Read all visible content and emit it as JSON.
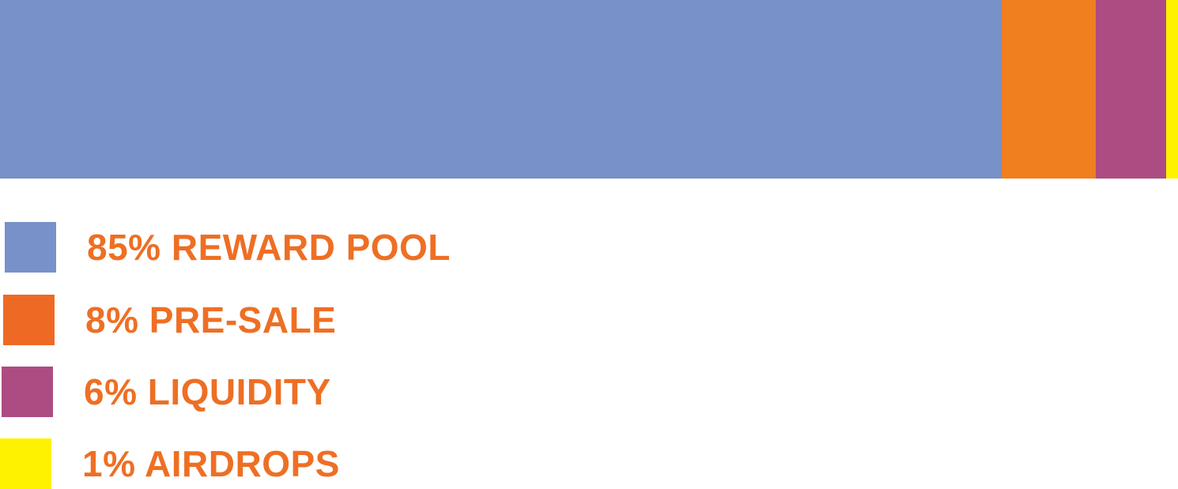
{
  "chart_data": {
    "type": "bar",
    "orientation": "horizontal-stacked",
    "unit": "%",
    "categories": [
      "REWARD POOL",
      "PRE-SALE",
      "LIQUIDITY",
      "AIRDROPS"
    ],
    "values": [
      85,
      8,
      6,
      1
    ],
    "colors": [
      "#7891c8",
      "#ef7f1f",
      "#ad4c82",
      "#fff200"
    ],
    "legend": {
      "placement": "bottom-left",
      "label_color": "#ee6f24",
      "entries": [
        {
          "label": "85% REWARD POOL",
          "color": "#7891c8"
        },
        {
          "label": "8% PRE-SALE",
          "color": "#ee6a24"
        },
        {
          "label": "6% LIQUIDITY",
          "color": "#ad4c82"
        },
        {
          "label": "1% AIRDROPS",
          "color": "#fff200"
        }
      ]
    },
    "title": "",
    "xlabel": "",
    "ylabel": "",
    "grid": false
  }
}
